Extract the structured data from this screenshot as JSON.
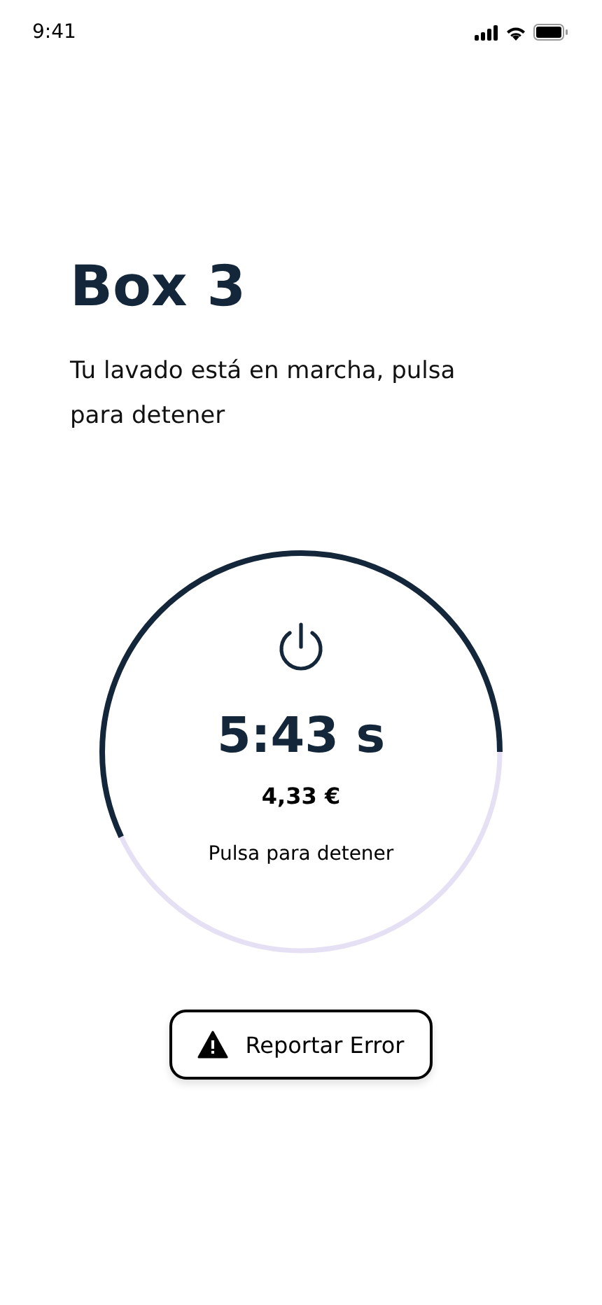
{
  "status_bar": {
    "time": "9:41"
  },
  "title": "Box 3",
  "subtitle": "Tu lavado está en marcha, pulsa para detener",
  "timer": {
    "level": 0.57,
    "time": "5:43 s",
    "price": "4,33 €",
    "hint": "Pulsa para detener"
  },
  "report_button": {
    "label": "Reportar Error"
  }
}
